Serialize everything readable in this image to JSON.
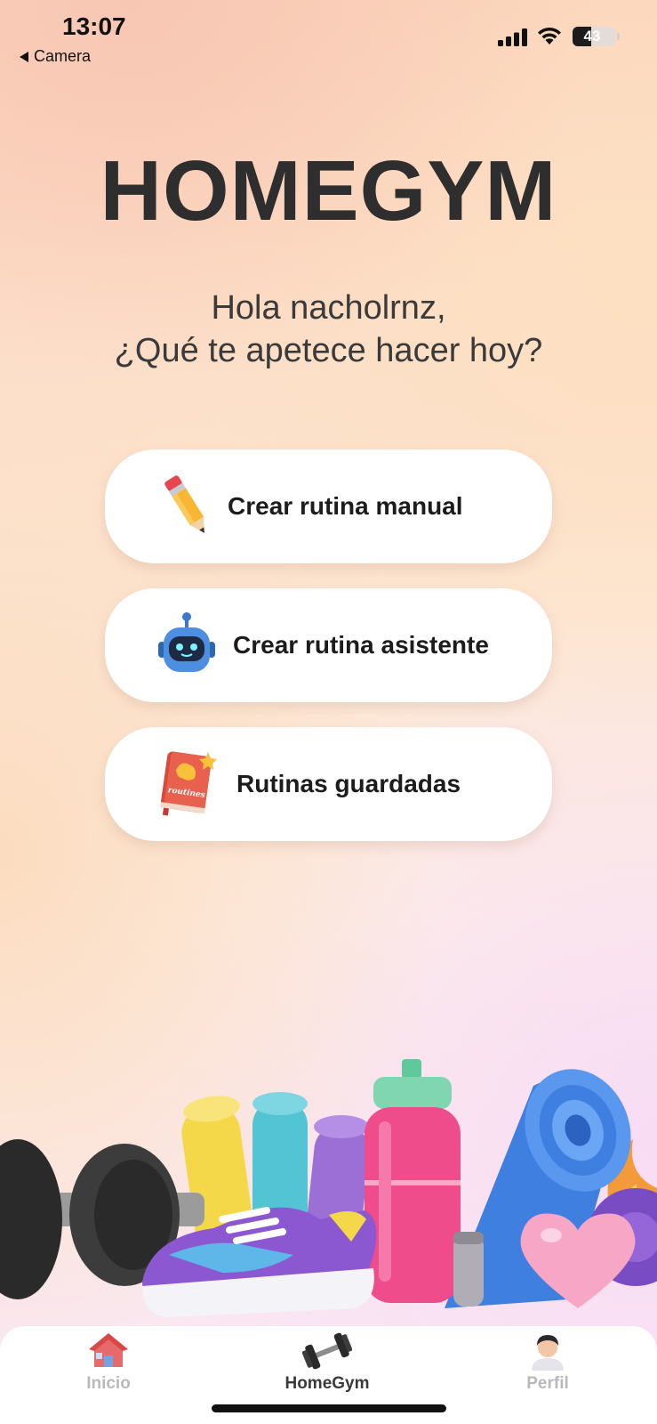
{
  "status_bar": {
    "time": "13:07",
    "back_label": "Camera",
    "battery": "43",
    "battery_level": 0.43
  },
  "header": {
    "title": "HOMEGYM",
    "greeting_line1": "Hola nacholrnz,",
    "greeting_line2": "¿Qué te apetece hacer hoy?"
  },
  "menu": {
    "items": [
      {
        "label": "Crear rutina manual",
        "icon": "pencil-icon"
      },
      {
        "label": "Crear rutina asistente",
        "icon": "robot-icon"
      },
      {
        "label": "Rutinas guardadas",
        "icon": "routine-book-icon",
        "icon_text": "routines"
      }
    ]
  },
  "tab_bar": {
    "tabs": [
      {
        "label": "Inicio",
        "icon": "house-icon",
        "active": false
      },
      {
        "label": "HomeGym",
        "icon": "dumbbell-icon",
        "active": true
      },
      {
        "label": "Perfil",
        "icon": "user-avatar-icon",
        "active": false
      }
    ]
  },
  "colors": {
    "title": "#2e2e2e",
    "button_bg": "#ffffff",
    "tab_inactive": "#b9b9b9",
    "tab_active": "#3a3a3a"
  }
}
